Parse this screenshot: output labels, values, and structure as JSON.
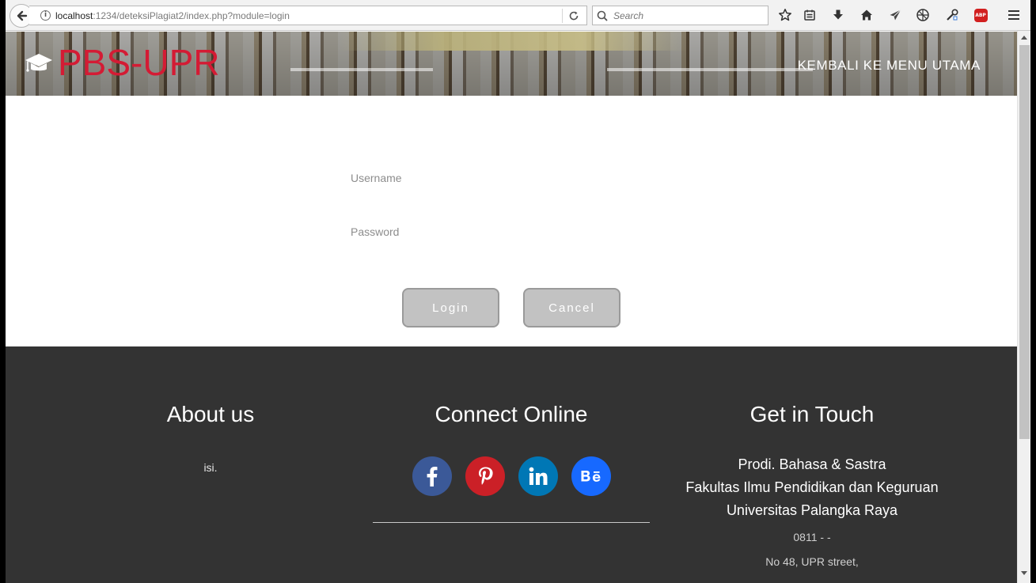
{
  "browser": {
    "url_host": "localhost",
    "url_rest": ":1234/deteksiPlagiat2/index.php?module=login",
    "search_placeholder": "Search",
    "adblock_label": "ABP"
  },
  "header": {
    "logo_text": "PBS-UPR",
    "nav_link": "KEMBALI KE MENU UTAMA"
  },
  "login": {
    "username_placeholder": "Username",
    "password_placeholder": "Password",
    "login_label": "Login",
    "cancel_label": "Cancel"
  },
  "footer": {
    "about": {
      "title": "About us",
      "text": "isi."
    },
    "connect": {
      "title": "Connect Online",
      "social": [
        "facebook",
        "pinterest",
        "linkedin",
        "behance"
      ]
    },
    "contact": {
      "title": "Get in Touch",
      "line1": "Prodi. Bahasa & Sastra",
      "line2": "Fakultas Ilmu Pendidikan dan Keguruan",
      "line3": "Universitas Palangka Raya",
      "phone": "0811 - -",
      "address": "No 48, UPR street,"
    }
  },
  "colors": {
    "brand_red": "#d41b34",
    "footer_bg": "#333333",
    "button_bg": "#c2c2c2",
    "facebook": "#3b5998",
    "pinterest": "#cb2027",
    "linkedin": "#0077b5",
    "behance": "#1769ff"
  }
}
